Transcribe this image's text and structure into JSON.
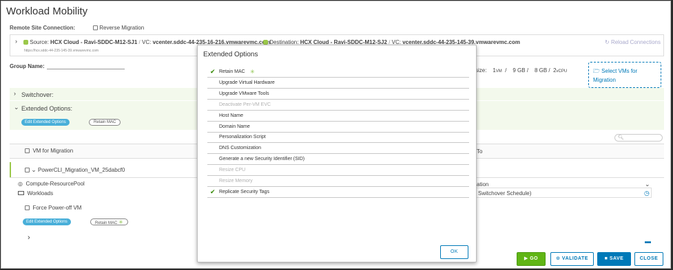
{
  "window": {
    "title": "Workload Mobility",
    "remote_site_label": "Remote Site Connection:",
    "reverse_migration_label": "Reverse Migration"
  },
  "connection": {
    "source_label": "Source:",
    "source_value": "HCX Cloud - Ravi-SDDC-M12-SJ1",
    "vc_label": "VC:",
    "vc_value": "vcenter.sddc-44-235-16-216.vmwarevmc.com",
    "destination_label": "Destination:",
    "destination_value": "HCX Cloud - Ravi-SDDC-M12-SJ2",
    "dest_vc_label": "VC:",
    "dest_vc_value": "vcenter.sddc-44-235-145-39.vmwarevmc.com",
    "sub_url": "https://hcx.sddc-44-235-145-39.vmwarevmc.com",
    "reload_label": "Reload Connections"
  },
  "group": {
    "name_label": "Group Name:",
    "size_label": "size:",
    "size_vm": "1",
    "size_vm_unit": "VM",
    "size_gb1": "9 GB",
    "size_gb2": "8 GB",
    "size_vcpu": "2",
    "size_vcpu_unit": "vCPU",
    "select_vms_label": "Select VMs for Migration"
  },
  "sections": {
    "switchover_label": "Switchover:",
    "extended_options_label": "Extended Options:",
    "edit_extended_options": "Edit Extended Options",
    "retain_mac": "Retain MAC"
  },
  "table": {
    "col_vm": "VM for Migration",
    "col_to": "To",
    "search_placeholder": "",
    "vm_name": "PowerCLI_Migration_VM_25dabcf0",
    "resource_pool": "Compute-ResourcePool",
    "workloads": "Workloads",
    "right_row1": "ation",
    "right_row2": "Switchover Schedule)",
    "force_poweroff": "Force Power-off VM",
    "edit_extended_options": "Edit Extended Options",
    "retain_mac": "Retain MAC"
  },
  "modal": {
    "title": "Extended Options",
    "ok_label": "OK",
    "options": [
      {
        "label": "Retain MAC",
        "checked": true,
        "disabled": false,
        "new": true
      },
      {
        "label": "Upgrade Virtual Hardware",
        "checked": false,
        "disabled": false
      },
      {
        "label": "Upgrade VMware Tools",
        "checked": false,
        "disabled": false
      },
      {
        "label": "Deactivate Per-VM EVC",
        "checked": false,
        "disabled": true
      },
      {
        "label": "Host Name",
        "checked": false,
        "disabled": false
      },
      {
        "label": "Domain Name",
        "checked": false,
        "disabled": false
      },
      {
        "label": "Personalization Script",
        "checked": false,
        "disabled": false
      },
      {
        "label": "DNS Customization",
        "checked": false,
        "disabled": false
      },
      {
        "label": "Generate a new Security Identifier (SID)",
        "checked": false,
        "disabled": false
      },
      {
        "label": "Resize CPU",
        "checked": false,
        "disabled": true
      },
      {
        "label": "Resize Memory",
        "checked": false,
        "disabled": true
      },
      {
        "label": "Replicate Security Tags",
        "checked": true,
        "disabled": false
      }
    ]
  },
  "footer": {
    "go": "GO",
    "validate": "VALIDATE",
    "save": "SAVE",
    "close": "CLOSE"
  },
  "colors": {
    "accent": "#0079b8",
    "go_green": "#60b515",
    "check_green": "#318700",
    "pill_blue": "#49afd9"
  }
}
